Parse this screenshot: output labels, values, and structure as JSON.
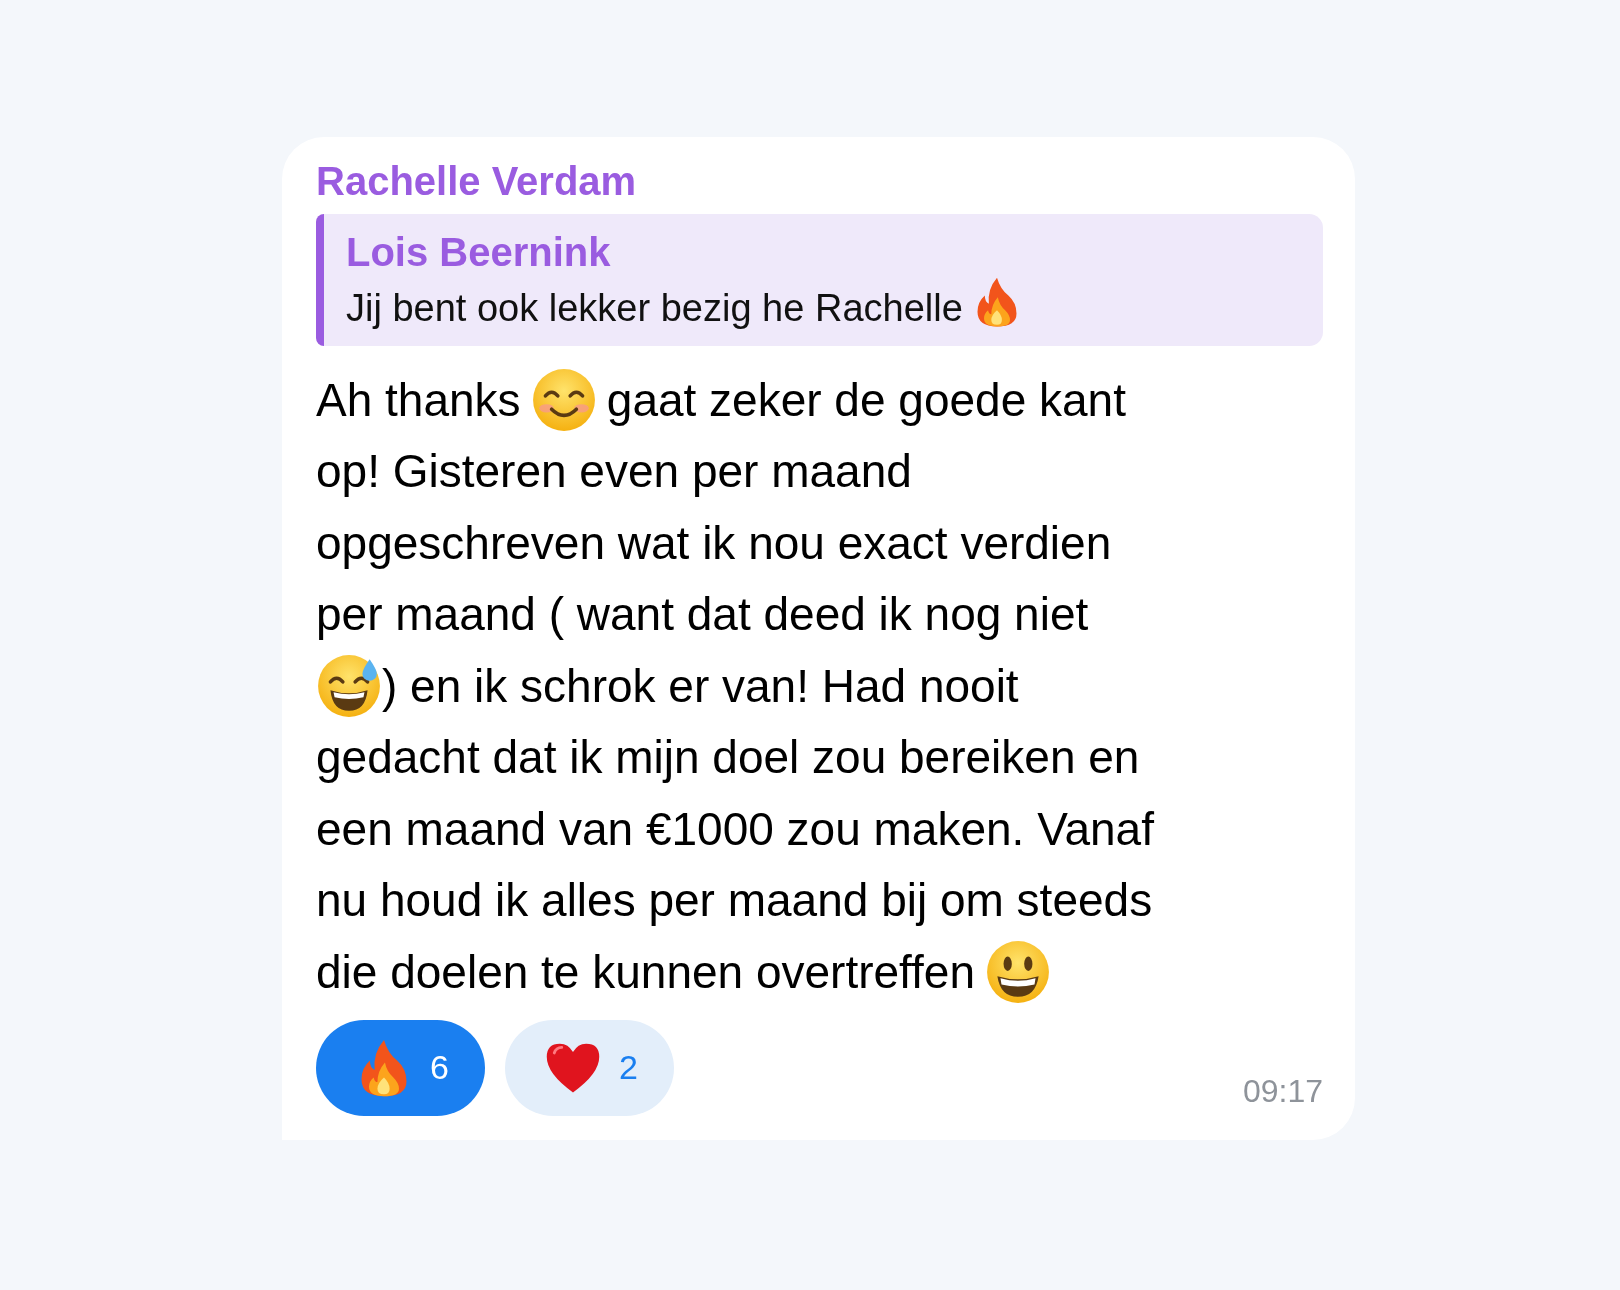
{
  "sender": "Rachelle Verdam",
  "reply": {
    "author": "Lois Beernink",
    "parts": [
      {
        "kind": "text",
        "text": "Jij bent ook lekker bezig he Rachelle"
      },
      {
        "kind": "fire"
      }
    ]
  },
  "message": {
    "lines": [
      [
        {
          "kind": "text",
          "text": "Ah thanks"
        },
        {
          "kind": "smiling"
        },
        {
          "kind": "text",
          "text": "gaat zeker de goede kant"
        }
      ],
      [
        {
          "kind": "text",
          "text": "op! Gisteren even per maand"
        }
      ],
      [
        {
          "kind": "text",
          "text": "opgeschreven wat ik nou exact verdien"
        }
      ],
      [
        {
          "kind": "text",
          "text": "per maand ( want dat deed ik nog niet"
        }
      ],
      [
        {
          "kind": "sweat-smile"
        },
        {
          "kind": "text",
          "text": ") en ik schrok er van! Had nooit"
        }
      ],
      [
        {
          "kind": "text",
          "text": "gedacht dat ik mijn doel zou bereiken en"
        }
      ],
      [
        {
          "kind": "text",
          "text": "een maand van €1000 zou maken. Vanaf"
        }
      ],
      [
        {
          "kind": "text",
          "text": "nu houd ik alles per maand bij om steeds"
        }
      ],
      [
        {
          "kind": "text",
          "text": "die doelen te kunnen overtreffen"
        },
        {
          "kind": "grinning"
        }
      ]
    ]
  },
  "reactions": [
    {
      "kind": "fire",
      "count": "6",
      "selected": true
    },
    {
      "kind": "heart",
      "count": "2",
      "selected": false
    }
  ],
  "time": "09:17"
}
